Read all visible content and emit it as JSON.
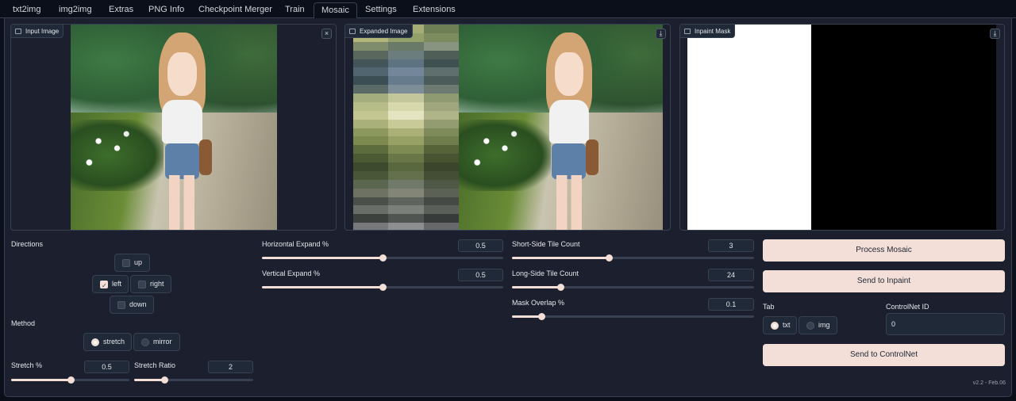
{
  "tabs": [
    {
      "label": "txt2img",
      "active": false
    },
    {
      "label": "img2img",
      "active": false
    },
    {
      "label": "Extras",
      "active": false
    },
    {
      "label": "PNG Info",
      "active": false
    },
    {
      "label": "Checkpoint Merger",
      "active": false
    },
    {
      "label": "Train",
      "active": false
    },
    {
      "label": "Mosaic",
      "active": true
    },
    {
      "label": "Settings",
      "active": false
    },
    {
      "label": "Extensions",
      "active": false
    }
  ],
  "images": {
    "input_label": "Input Image",
    "expanded_label": "Expanded Image",
    "mask_label": "Inpaint Mask",
    "close_icon": "×",
    "download_icon": "⤓"
  },
  "directions": {
    "label": "Directions",
    "up": {
      "label": "up",
      "checked": false
    },
    "left": {
      "label": "left",
      "checked": true
    },
    "right": {
      "label": "right",
      "checked": false
    },
    "down": {
      "label": "down",
      "checked": false
    }
  },
  "method": {
    "label": "Method",
    "options": [
      {
        "label": "stretch",
        "selected": true
      },
      {
        "label": "mirror",
        "selected": false
      }
    ]
  },
  "stretch_pct": {
    "label": "Stretch %",
    "value": "0.5",
    "fraction": 0.5
  },
  "stretch_ratio": {
    "label": "Stretch Ratio",
    "value": "2",
    "fraction": 0.25
  },
  "horizontal_expand": {
    "label": "Horizontal Expand %",
    "value": "0.5",
    "fraction": 0.5
  },
  "vertical_expand": {
    "label": "Vertical Expand %",
    "value": "0.5",
    "fraction": 0.5
  },
  "short_side_tiles": {
    "label": "Short-Side Tile Count",
    "value": "3",
    "fraction": 0.4
  },
  "long_side_tiles": {
    "label": "Long-Side Tile Count",
    "value": "24",
    "fraction": 0.2
  },
  "mask_overlap": {
    "label": "Mask Overlap %",
    "value": "0.1",
    "fraction": 0.12
  },
  "buttons": {
    "process": "Process Mosaic",
    "send_inpaint": "Send to Inpaint",
    "send_controlnet": "Send to ControlNet"
  },
  "tab_select": {
    "label": "Tab",
    "options": [
      {
        "label": "txt",
        "selected": true
      },
      {
        "label": "img",
        "selected": false
      }
    ]
  },
  "controlnet_id": {
    "label": "ControlNet ID",
    "value": "0"
  },
  "version": "v2.2 - Feb.06",
  "colors": {
    "accent": "#f3ded8",
    "background": "#0b0f19",
    "panel": "#1b1f2e",
    "border": "#374151"
  },
  "mosaic_colors": [
    "#8c9a5a",
    "#a5ad74",
    "#6f7f55",
    "#b4b679",
    "#94a06a",
    "#7d8c5f",
    "#7f8d6d",
    "#6a7a68",
    "#889380",
    "#59675c",
    "#6c7d7d",
    "#4f5f58",
    "#44555a",
    "#5d7382",
    "#3e5150",
    "#506570",
    "#74879a",
    "#5e6f6d",
    "#3b4e53",
    "#667c8d",
    "#4a5b5a",
    "#5a6a66",
    "#7d8e99",
    "#6d7a72",
    "#a4ad7e",
    "#c2c69a",
    "#8f9a72",
    "#b7bd89",
    "#d7d9ad",
    "#9fa67e",
    "#c3c691",
    "#e4e4c2",
    "#b0b489",
    "#a9b07a",
    "#c8cb97",
    "#939b70",
    "#8d985f",
    "#aab078",
    "#7f8a5a",
    "#7c8a4f",
    "#98a165",
    "#6f7c4b",
    "#5d6c3c",
    "#7e8b52",
    "#566338",
    "#4c5a33",
    "#697648",
    "#475331",
    "#3d4a2e",
    "#5a6840",
    "#3a452c",
    "#4a5638",
    "#63704b",
    "#434e34",
    "#5b6650",
    "#70796a",
    "#4f5847",
    "#6d7262",
    "#838576",
    "#5c6156",
    "#4a4f4a",
    "#5e635d",
    "#444944",
    "#6a6e69",
    "#7c807b",
    "#5b5f5a",
    "#3c413e",
    "#505552",
    "#373b39",
    "#77797a",
    "#8c8e8f",
    "#666869"
  ]
}
